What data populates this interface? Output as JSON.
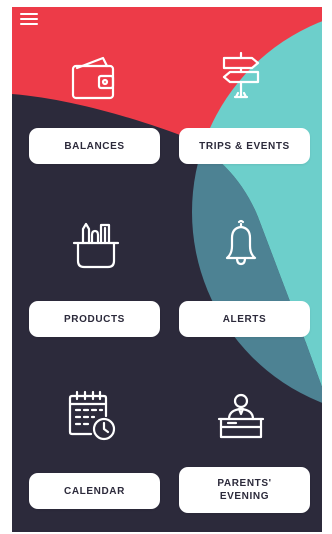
{
  "colors": {
    "red": "#ed3b48",
    "navy": "#2c2a3b",
    "teal": "#6dcfcb",
    "slate": "#4d8293",
    "button_bg": "#ffffff",
    "button_text": "#2c2a3b",
    "icon_stroke": "#ffffff"
  },
  "header": {
    "menu_icon": "hamburger-menu-icon"
  },
  "tiles": [
    {
      "label": "BALANCES",
      "icon": "wallet-icon"
    },
    {
      "label": "TRIPS & EVENTS",
      "icon": "signpost-icon"
    },
    {
      "label": "PRODUCTS",
      "icon": "pencil-cup-icon"
    },
    {
      "label": "ALERTS",
      "icon": "bell-icon"
    },
    {
      "label": "CALENDAR",
      "icon": "calendar-clock-icon"
    },
    {
      "label": "PARENTS'\nEVENING",
      "icon": "reception-desk-icon"
    }
  ]
}
